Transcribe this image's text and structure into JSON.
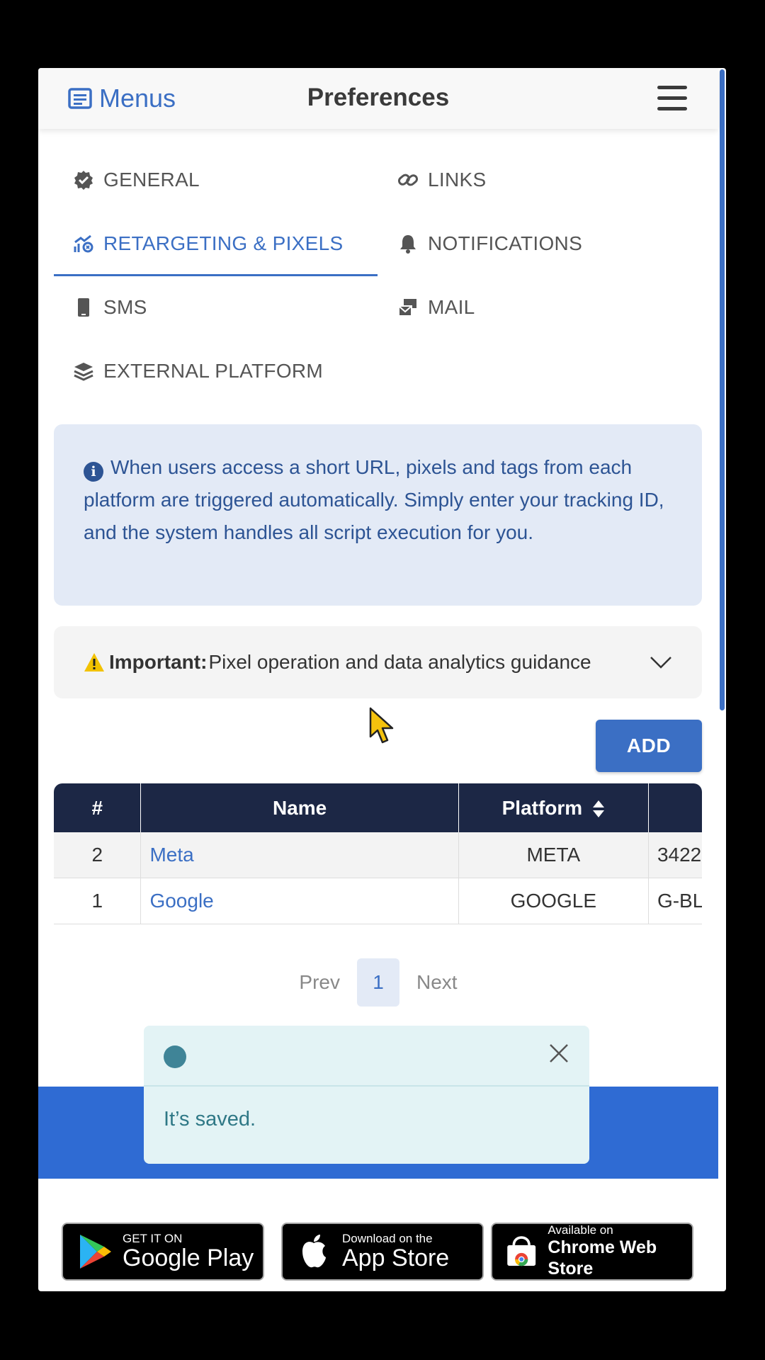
{
  "topbar": {
    "menus_label": "Menus",
    "title": "Preferences"
  },
  "tabs": [
    {
      "label": "GENERAL",
      "icon": "badge-check-icon"
    },
    {
      "label": "LINKS",
      "icon": "link-icon"
    },
    {
      "label": "RETARGETING & PIXELS",
      "icon": "chart-pixel-icon",
      "active": true
    },
    {
      "label": "NOTIFICATIONS",
      "icon": "bell-icon"
    },
    {
      "label": "SMS",
      "icon": "mobile-icon"
    },
    {
      "label": "MAIL",
      "icon": "mail-bulk-icon"
    },
    {
      "label": "EXTERNAL PLATFORM",
      "icon": "layers-icon"
    }
  ],
  "info": {
    "text": "When users access a short URL, pixels and tags from each platform are triggered automatically. Simply enter your tracking ID, and the system handles all script execution for you."
  },
  "important": {
    "label": "Important:",
    "text": "Pixel operation and data analytics guidance"
  },
  "add_label": "ADD",
  "table": {
    "headers": [
      "#",
      "Name",
      "Platform",
      ""
    ],
    "rows": [
      {
        "num": "2",
        "name": "Meta",
        "platform": "META",
        "id": "3422"
      },
      {
        "num": "1",
        "name": "Google",
        "platform": "GOOGLE",
        "id": "G-BL"
      }
    ]
  },
  "pager": {
    "prev": "Prev",
    "current": "1",
    "next": "Next"
  },
  "toast": {
    "message": "It’s saved."
  },
  "badges": {
    "google": {
      "small": "GET IT ON",
      "large": "Google Play"
    },
    "apple": {
      "small": "Download on the",
      "large": "App Store"
    },
    "chrome": {
      "small": "Available on",
      "large": "Chrome Web Store"
    }
  },
  "colors": {
    "accent": "#3b6fc4",
    "table_header": "#1c2745",
    "footer": "#2f6bd3"
  }
}
